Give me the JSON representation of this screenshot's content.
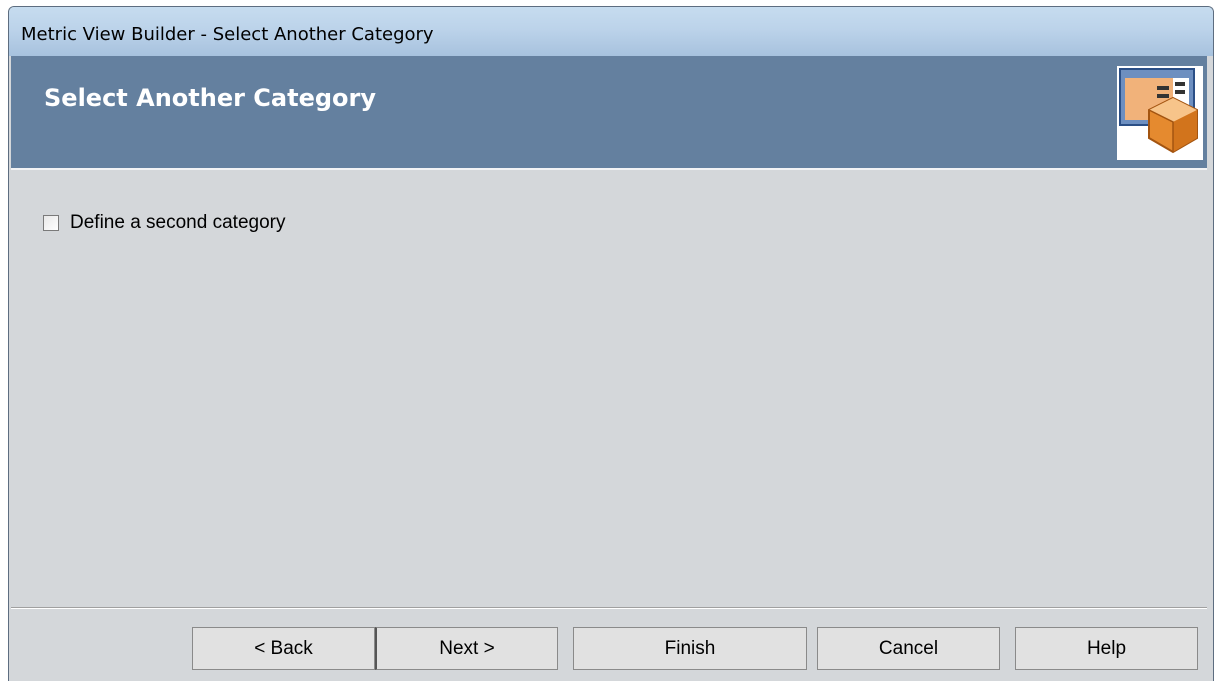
{
  "window": {
    "title": "Metric View Builder - Select Another Category"
  },
  "header": {
    "title": "Select Another Category",
    "icon": "wizard-form-box-icon"
  },
  "content": {
    "second_category_checkbox": {
      "label": "Define a second category",
      "checked": false
    }
  },
  "footer": {
    "back_label": "< Back",
    "next_label": "Next >",
    "finish_label": "Finish",
    "cancel_label": "Cancel",
    "help_label": "Help"
  },
  "colors": {
    "header_band": "#64809f",
    "title_bar": "#bcd3ea",
    "dialog_background": "#d4d7da",
    "icon_box": "#f0a050"
  }
}
